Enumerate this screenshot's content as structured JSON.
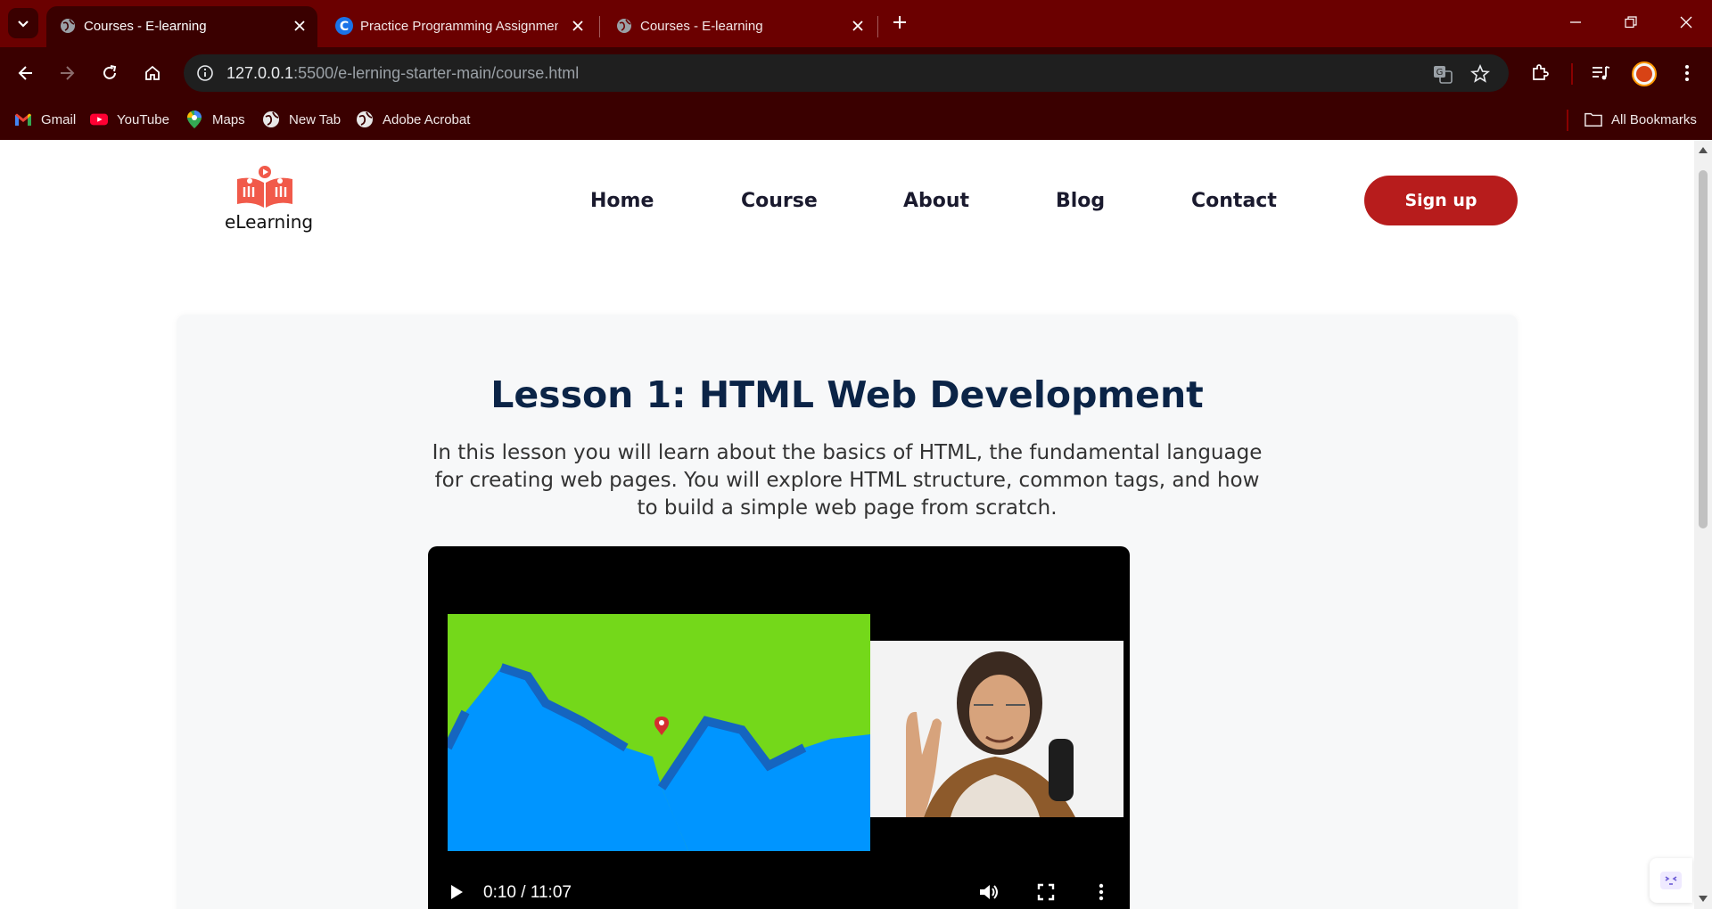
{
  "browser": {
    "tabs": [
      {
        "title": "Courses - E-learning",
        "active": true
      },
      {
        "title": "Practice Programming Assignment",
        "active": false
      },
      {
        "title": "Courses - E-learning",
        "active": false
      }
    ],
    "url_host": "127.0.0.1",
    "url_rest": ":5500/e-lerning-starter-main/course.html",
    "bookmarks": [
      "Gmail",
      "YouTube",
      "Maps",
      "New Tab",
      "Adobe Acrobat"
    ],
    "all_bookmarks": "All Bookmarks",
    "colors": {
      "frame": "#6b0000",
      "toolbar": "#3a0000"
    }
  },
  "site": {
    "logo_text": "eLearning",
    "nav": [
      "Home",
      "Course",
      "About",
      "Blog",
      "Contact"
    ],
    "signup": "Sign up",
    "colors": {
      "accent": "#b71c1c",
      "title": "#0b2447"
    }
  },
  "lesson": {
    "title": "Lesson 1: HTML Web Development",
    "description": "In this lesson you will learn about the basics of HTML, the fundamental language for creating web pages. You will explore HTML structure, common tags, and how to build a simple web page from scratch."
  },
  "video": {
    "time": "0:10 / 11:07"
  }
}
